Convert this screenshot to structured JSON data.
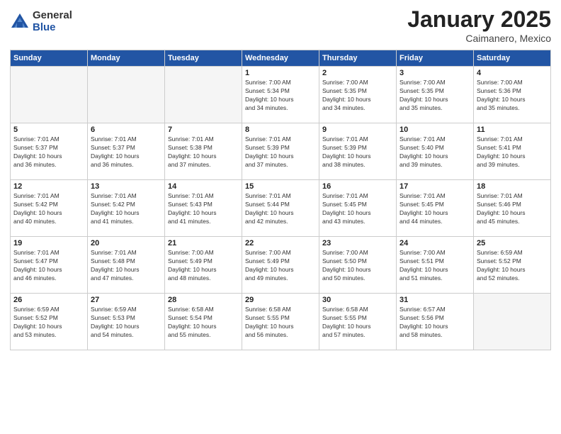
{
  "header": {
    "logo_general": "General",
    "logo_blue": "Blue",
    "month_title": "January 2025",
    "location": "Caimanero, Mexico"
  },
  "days_of_week": [
    "Sunday",
    "Monday",
    "Tuesday",
    "Wednesday",
    "Thursday",
    "Friday",
    "Saturday"
  ],
  "weeks": [
    [
      {
        "day": "",
        "info": ""
      },
      {
        "day": "",
        "info": ""
      },
      {
        "day": "",
        "info": ""
      },
      {
        "day": "1",
        "info": "Sunrise: 7:00 AM\nSunset: 5:34 PM\nDaylight: 10 hours\nand 34 minutes."
      },
      {
        "day": "2",
        "info": "Sunrise: 7:00 AM\nSunset: 5:35 PM\nDaylight: 10 hours\nand 34 minutes."
      },
      {
        "day": "3",
        "info": "Sunrise: 7:00 AM\nSunset: 5:35 PM\nDaylight: 10 hours\nand 35 minutes."
      },
      {
        "day": "4",
        "info": "Sunrise: 7:00 AM\nSunset: 5:36 PM\nDaylight: 10 hours\nand 35 minutes."
      }
    ],
    [
      {
        "day": "5",
        "info": "Sunrise: 7:01 AM\nSunset: 5:37 PM\nDaylight: 10 hours\nand 36 minutes."
      },
      {
        "day": "6",
        "info": "Sunrise: 7:01 AM\nSunset: 5:37 PM\nDaylight: 10 hours\nand 36 minutes."
      },
      {
        "day": "7",
        "info": "Sunrise: 7:01 AM\nSunset: 5:38 PM\nDaylight: 10 hours\nand 37 minutes."
      },
      {
        "day": "8",
        "info": "Sunrise: 7:01 AM\nSunset: 5:39 PM\nDaylight: 10 hours\nand 37 minutes."
      },
      {
        "day": "9",
        "info": "Sunrise: 7:01 AM\nSunset: 5:39 PM\nDaylight: 10 hours\nand 38 minutes."
      },
      {
        "day": "10",
        "info": "Sunrise: 7:01 AM\nSunset: 5:40 PM\nDaylight: 10 hours\nand 39 minutes."
      },
      {
        "day": "11",
        "info": "Sunrise: 7:01 AM\nSunset: 5:41 PM\nDaylight: 10 hours\nand 39 minutes."
      }
    ],
    [
      {
        "day": "12",
        "info": "Sunrise: 7:01 AM\nSunset: 5:42 PM\nDaylight: 10 hours\nand 40 minutes."
      },
      {
        "day": "13",
        "info": "Sunrise: 7:01 AM\nSunset: 5:42 PM\nDaylight: 10 hours\nand 41 minutes."
      },
      {
        "day": "14",
        "info": "Sunrise: 7:01 AM\nSunset: 5:43 PM\nDaylight: 10 hours\nand 41 minutes."
      },
      {
        "day": "15",
        "info": "Sunrise: 7:01 AM\nSunset: 5:44 PM\nDaylight: 10 hours\nand 42 minutes."
      },
      {
        "day": "16",
        "info": "Sunrise: 7:01 AM\nSunset: 5:45 PM\nDaylight: 10 hours\nand 43 minutes."
      },
      {
        "day": "17",
        "info": "Sunrise: 7:01 AM\nSunset: 5:45 PM\nDaylight: 10 hours\nand 44 minutes."
      },
      {
        "day": "18",
        "info": "Sunrise: 7:01 AM\nSunset: 5:46 PM\nDaylight: 10 hours\nand 45 minutes."
      }
    ],
    [
      {
        "day": "19",
        "info": "Sunrise: 7:01 AM\nSunset: 5:47 PM\nDaylight: 10 hours\nand 46 minutes."
      },
      {
        "day": "20",
        "info": "Sunrise: 7:01 AM\nSunset: 5:48 PM\nDaylight: 10 hours\nand 47 minutes."
      },
      {
        "day": "21",
        "info": "Sunrise: 7:00 AM\nSunset: 5:49 PM\nDaylight: 10 hours\nand 48 minutes."
      },
      {
        "day": "22",
        "info": "Sunrise: 7:00 AM\nSunset: 5:49 PM\nDaylight: 10 hours\nand 49 minutes."
      },
      {
        "day": "23",
        "info": "Sunrise: 7:00 AM\nSunset: 5:50 PM\nDaylight: 10 hours\nand 50 minutes."
      },
      {
        "day": "24",
        "info": "Sunrise: 7:00 AM\nSunset: 5:51 PM\nDaylight: 10 hours\nand 51 minutes."
      },
      {
        "day": "25",
        "info": "Sunrise: 6:59 AM\nSunset: 5:52 PM\nDaylight: 10 hours\nand 52 minutes."
      }
    ],
    [
      {
        "day": "26",
        "info": "Sunrise: 6:59 AM\nSunset: 5:52 PM\nDaylight: 10 hours\nand 53 minutes."
      },
      {
        "day": "27",
        "info": "Sunrise: 6:59 AM\nSunset: 5:53 PM\nDaylight: 10 hours\nand 54 minutes."
      },
      {
        "day": "28",
        "info": "Sunrise: 6:58 AM\nSunset: 5:54 PM\nDaylight: 10 hours\nand 55 minutes."
      },
      {
        "day": "29",
        "info": "Sunrise: 6:58 AM\nSunset: 5:55 PM\nDaylight: 10 hours\nand 56 minutes."
      },
      {
        "day": "30",
        "info": "Sunrise: 6:58 AM\nSunset: 5:55 PM\nDaylight: 10 hours\nand 57 minutes."
      },
      {
        "day": "31",
        "info": "Sunrise: 6:57 AM\nSunset: 5:56 PM\nDaylight: 10 hours\nand 58 minutes."
      },
      {
        "day": "",
        "info": ""
      }
    ]
  ]
}
